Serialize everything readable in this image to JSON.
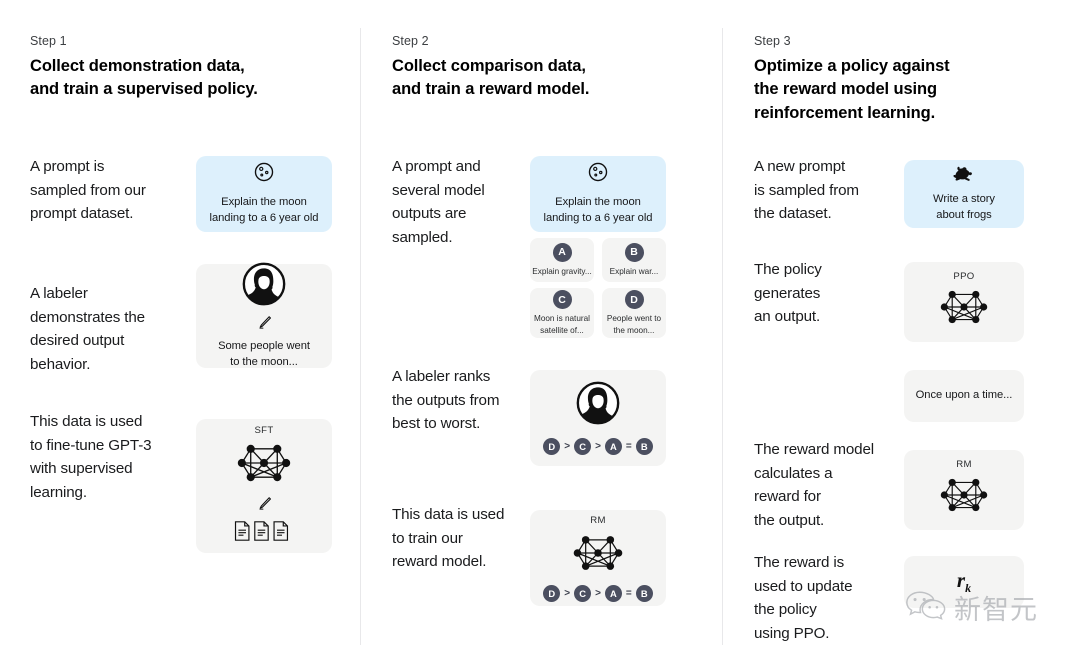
{
  "diagram": {
    "title": "InstructGPT / RLHF three-step training diagram",
    "colors": {
      "prompt_card_bg": "#ddf0fc",
      "card_bg": "#f4f4f3",
      "arrow_gray": "#9ea0b0",
      "arrow_blue": "#44b0f5",
      "badge_bg": "#4b4f60",
      "divider": "#e8e8ea"
    }
  },
  "columns": [
    {
      "step_label": "Step 1",
      "title": "Collect demonstration data,\nand train a supervised policy.",
      "paragraphs": [
        "A prompt is\nsampled from our\nprompt dataset.",
        "A labeler\ndemonstrates the\ndesired output\nbehavior.",
        "This data is used\nto fine-tune GPT-3\nwith supervised\nlearning."
      ],
      "cards": [
        {
          "icon": "moon-icon",
          "text": "Explain the moon\nlanding to a 6 year old",
          "kind": "prompt"
        },
        {
          "icon": "labeler-avatar-icon",
          "sub_icon": "pencil-icon",
          "text": "Some people went\nto the moon...",
          "kind": "plain"
        },
        {
          "tag": "SFT",
          "icon": "neural-network-icon",
          "sub_icon": "pencil-icon",
          "extra_icon": "documents-icon",
          "kind": "plain"
        }
      ]
    },
    {
      "step_label": "Step 2",
      "title": "Collect comparison data,\nand train a reward model.",
      "paragraphs": [
        "A prompt and\nseveral model\noutputs are\nsampled.",
        "A labeler ranks\nthe outputs from\nbest to worst.",
        "This data is used\nto train our\nreward model."
      ],
      "cards": [
        {
          "icon": "moon-icon",
          "text": "Explain the moon\nlanding to a 6 year old",
          "kind": "prompt"
        },
        {
          "icon": "labeler-avatar-icon",
          "ranking": "D > C > A = B",
          "kind": "plain"
        },
        {
          "tag": "RM",
          "icon": "neural-network-icon",
          "ranking": "D > C > A = B",
          "kind": "plain"
        }
      ],
      "options": [
        {
          "letter": "A",
          "text": "Explain gravity..."
        },
        {
          "letter": "B",
          "text": "Explain war..."
        },
        {
          "letter": "C",
          "text": "Moon is natural\nsatellite of..."
        },
        {
          "letter": "D",
          "text": "People went to\nthe moon..."
        }
      ],
      "ranking_tokens": [
        {
          "type": "badge",
          "value": "D"
        },
        {
          "type": "op",
          "value": ">"
        },
        {
          "type": "badge",
          "value": "C"
        },
        {
          "type": "op",
          "value": ">"
        },
        {
          "type": "badge",
          "value": "A"
        },
        {
          "type": "op",
          "value": "="
        },
        {
          "type": "badge",
          "value": "B"
        }
      ]
    },
    {
      "step_label": "Step 3",
      "title": "Optimize a policy against\nthe reward model using\nreinforcement learning.",
      "paragraphs": [
        "A new prompt\nis sampled from\nthe dataset.",
        "The policy\ngenerates\nan output.",
        "The reward model\ncalculates a\nreward for\nthe output.",
        "The reward is\nused to update\nthe policy\nusing PPO."
      ],
      "cards": [
        {
          "icon": "frog-icon",
          "text": "Write a story\nabout frogs",
          "kind": "prompt"
        },
        {
          "tag": "PPO",
          "icon": "neural-network-icon",
          "kind": "plain"
        },
        {
          "text": "Once upon a time...",
          "kind": "plain"
        },
        {
          "tag": "RM",
          "icon": "neural-network-icon",
          "kind": "plain"
        },
        {
          "reward_symbol": "r",
          "reward_subscript": "k",
          "kind": "plain"
        }
      ]
    }
  ],
  "watermark": {
    "icon": "wechat-icon",
    "text": "新智元"
  }
}
